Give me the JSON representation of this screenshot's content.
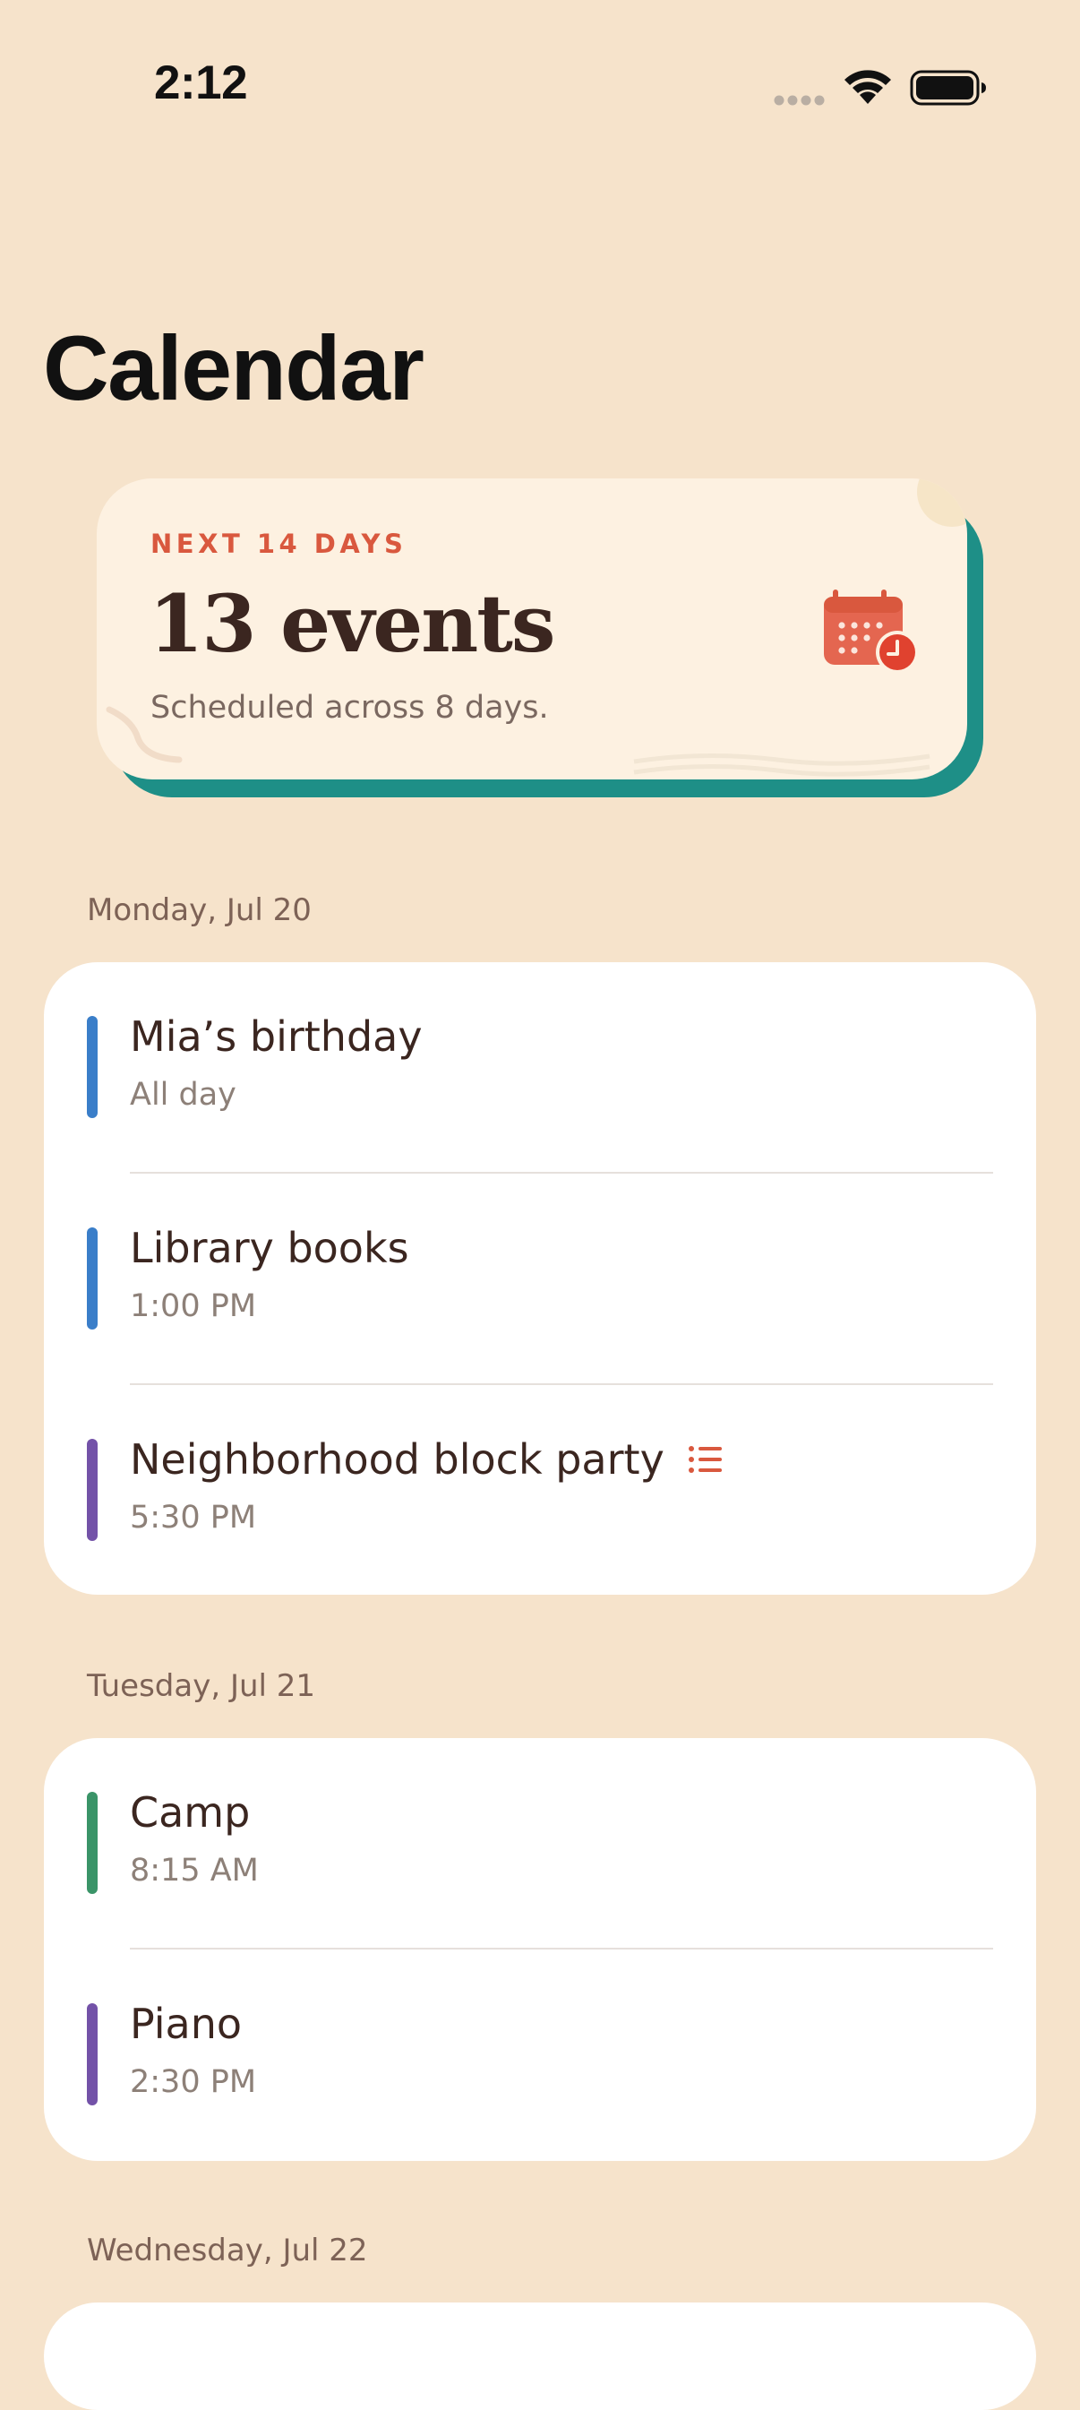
{
  "status_bar": {
    "time": "2:12"
  },
  "page": {
    "title": "Calendar"
  },
  "summary": {
    "eyebrow": "NEXT 14 DAYS",
    "count": "13 events",
    "subtitle": "Scheduled across 8 days.",
    "icon": "calendar-clock-icon"
  },
  "colors": {
    "background": "#f6e3cb",
    "card": "#fdf1e1",
    "card_shadow": "#1e8f87",
    "accent": "#d9583e",
    "event_blue": "#3a7ec9",
    "event_purple": "#7352a8",
    "event_green": "#3a9468"
  },
  "sections": [
    {
      "header": "Monday, Jul 20",
      "events": [
        {
          "title": "Mia’s birthday",
          "time": "All day",
          "color": "#3a7ec9"
        },
        {
          "title": "Library books",
          "time": "1:00 PM",
          "color": "#3a7ec9"
        },
        {
          "title": "Neighborhood block party",
          "time": "5:30 PM",
          "color": "#7352a8",
          "icon": "list-icon"
        }
      ]
    },
    {
      "header": "Tuesday, Jul 21",
      "events": [
        {
          "title": "Camp",
          "time": "8:15 AM",
          "color": "#3a9468"
        },
        {
          "title": "Piano",
          "time": "2:30 PM",
          "color": "#7352a8"
        }
      ]
    },
    {
      "header": "Wednesday, Jul 22",
      "events": []
    }
  ]
}
